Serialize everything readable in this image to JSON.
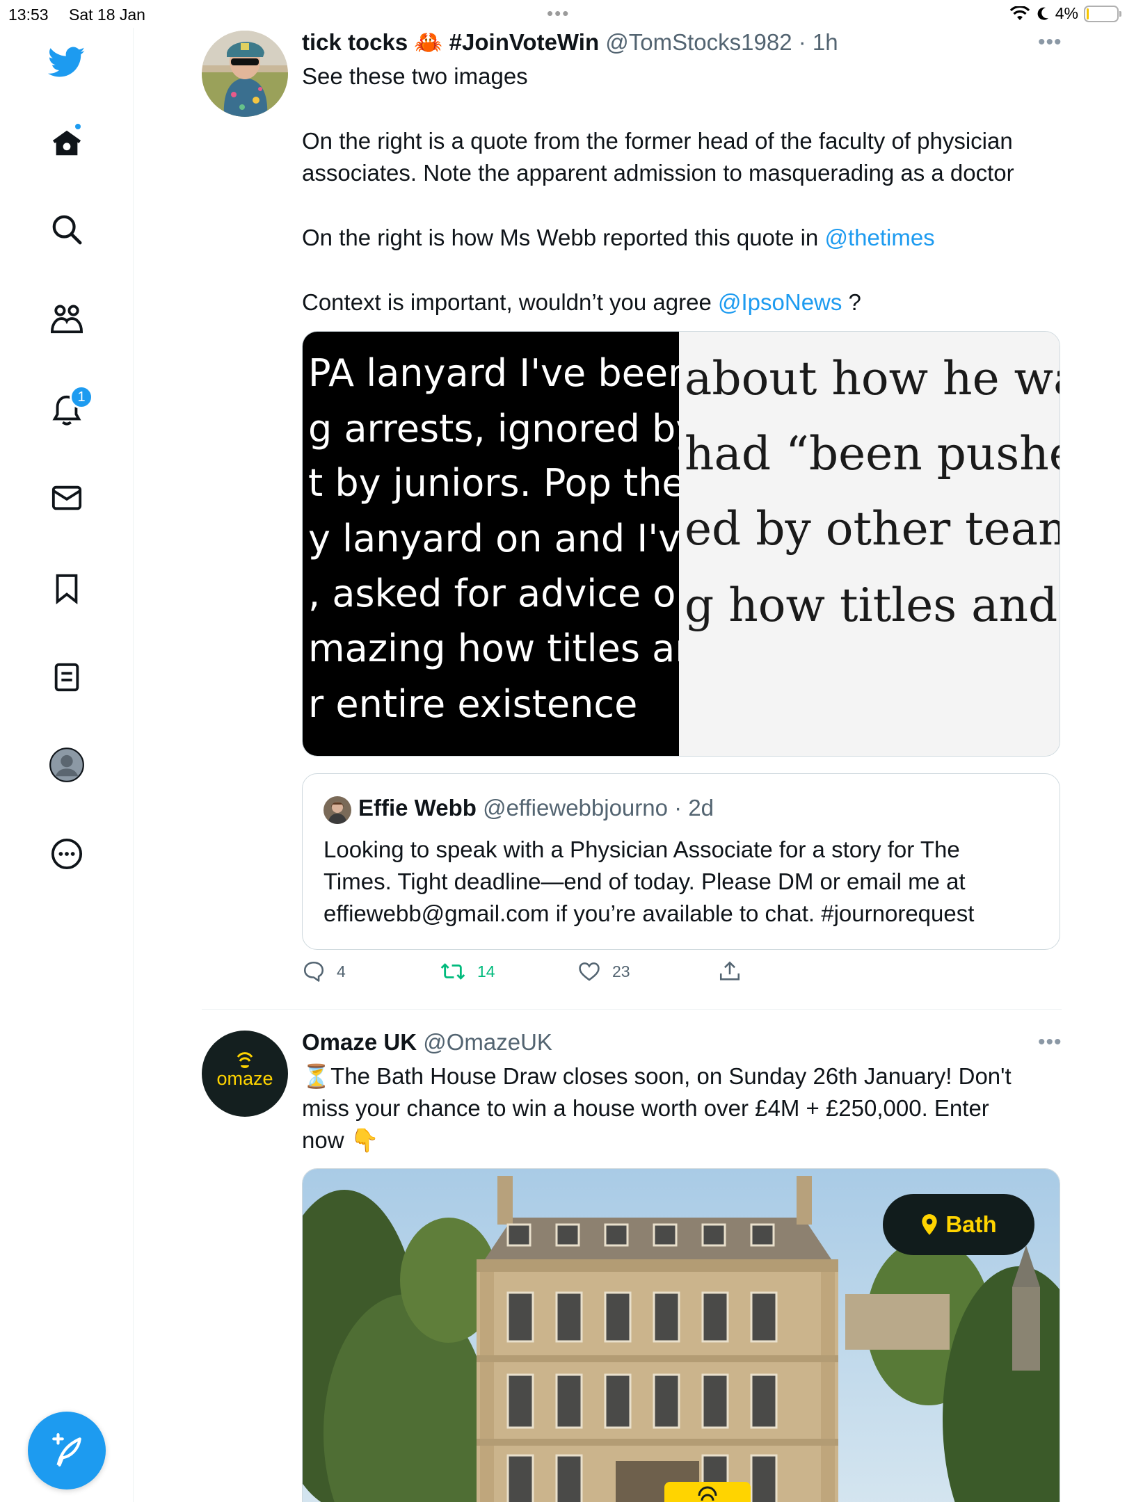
{
  "status_bar": {
    "time": "13:53",
    "date": "Sat 18 Jan",
    "battery": "4%"
  },
  "sidebar": {
    "items": [
      {
        "icon": "twitter-logo-icon",
        "label": "Twitter"
      },
      {
        "icon": "home-icon",
        "label": "Home"
      },
      {
        "icon": "search-icon",
        "label": "Explore"
      },
      {
        "icon": "communities-icon",
        "label": "Communities"
      },
      {
        "icon": "notifications-bell-icon",
        "label": "Notifications",
        "badge": "1"
      },
      {
        "icon": "messages-envelope-icon",
        "label": "Messages"
      },
      {
        "icon": "bookmark-icon",
        "label": "Bookmarks"
      },
      {
        "icon": "lists-icon",
        "label": "Lists"
      },
      {
        "icon": "profile-icon",
        "label": "Profile"
      },
      {
        "icon": "more-circle-icon",
        "label": "More"
      }
    ],
    "compose_icon": "compose-tweet-icon"
  },
  "tweets": [
    {
      "name": "tick tocks 🦀 #JoinVoteWin",
      "handle": "@TomStocks1982",
      "time": "· 1h",
      "lines": {
        "l1": "See these two images",
        "l2": "On the right is a quote from the former head of the faculty of physician",
        "l3": "associates. Note the apparent admission to masquerading as a doctor",
        "l4_pre": "On the right is how Ms Webb reported this quote in ",
        "l4_link": "@thetimes",
        "l5_pre": "Context is important, wouldn’t you agree ",
        "l5_link": "@IpsoNews",
        "l5_post": " ?"
      },
      "image_left_lines": [
        "PA lanyard I've been",
        "g arrests, ignored by o",
        "t by juniors. Pop the",
        "y lanyard on and I've",
        ", asked for advice on",
        "mazing how titles and",
        "r entire existence"
      ],
      "image_right_lines": [
        "about how he was",
        "had “been pushed",
        "ed by other teams",
        "g how titles and ur"
      ],
      "quote": {
        "name": "Effie Webb",
        "handle": "@effiewebbjourno",
        "time": "· 2d",
        "line1": "Looking to speak with a Physician Associate for a story for The",
        "line2": "Times. Tight deadline—end of today. Please DM or email me at",
        "line3": "effiewebb@gmail.com if you’re available to chat. #journorequest"
      },
      "stats": {
        "replies": "4",
        "retweets": "14",
        "likes": "23"
      }
    },
    {
      "name": "Omaze UK",
      "handle": "@OmazeUK",
      "time": "",
      "lines": {
        "l1": "⏳The Bath House Draw closes soon, on Sunday 26th January! Don't",
        "l2": "miss your chance to win a house worth over £4M + £250,000. Enter",
        "l3": "now 👇"
      },
      "avatar_text": "omaze",
      "image": {
        "location_pill": "Bath",
        "banner_logo": "omaze"
      }
    }
  ],
  "colors": {
    "accent": "#1d9bf0",
    "retweet_green": "#00ba7c",
    "text": "#0f1419",
    "muted": "#536471",
    "omaze_yellow": "#ffd400"
  }
}
